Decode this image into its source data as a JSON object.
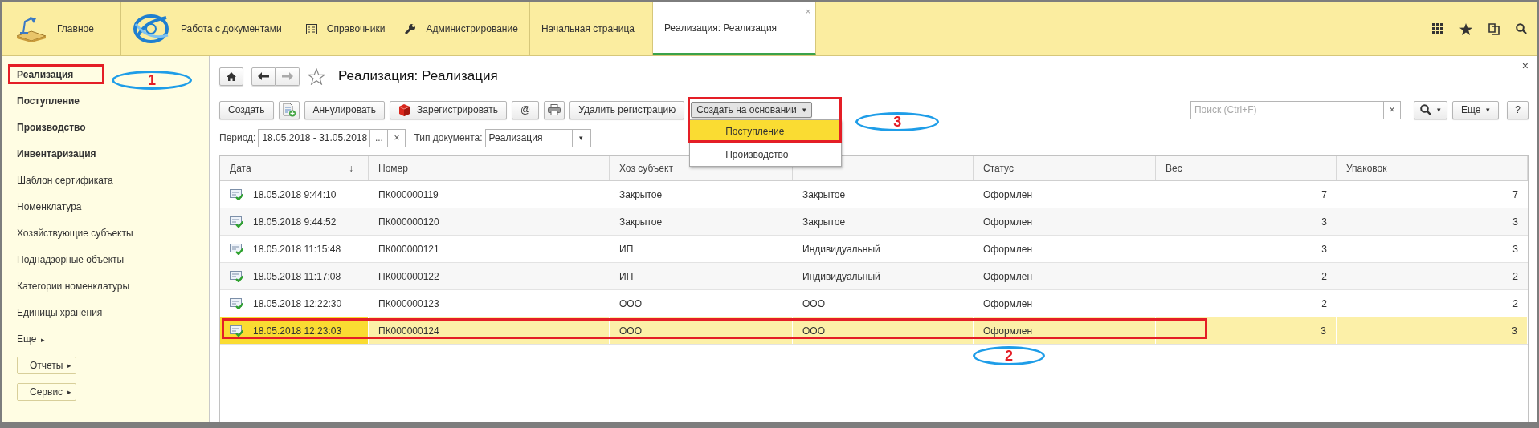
{
  "top_nav": {
    "sections": [
      {
        "label": "Главное"
      },
      {
        "label": "Работа с документами"
      },
      {
        "label": "Справочники"
      },
      {
        "label": "Администрирование"
      }
    ],
    "tabs": [
      {
        "label": "Начальная страница",
        "selected": false
      },
      {
        "label": "Реализация: Реализация",
        "selected": true,
        "close": "×"
      }
    ]
  },
  "sidebar": {
    "items": [
      {
        "label": "Реализация",
        "bold": true,
        "annotation": "1"
      },
      {
        "label": "Поступление",
        "bold": true
      },
      {
        "label": "Производство",
        "bold": true
      },
      {
        "label": "Инвентаризация",
        "bold": true
      },
      {
        "label": "Шаблон сертификата",
        "bold": false
      },
      {
        "label": "Номенклатура",
        "bold": false
      },
      {
        "label": "Хозяйствующие субъекты",
        "bold": false
      },
      {
        "label": "Поднадзорные объекты",
        "bold": false
      },
      {
        "label": "Категории номенклатуры",
        "bold": false
      },
      {
        "label": "Единицы хранения",
        "bold": false
      }
    ],
    "more": {
      "label": "Еще",
      "arrow": "▸"
    },
    "buttons": [
      {
        "label": "Отчеты",
        "arrow": "▸"
      },
      {
        "label": "Сервис",
        "arrow": "▸"
      }
    ]
  },
  "form": {
    "title": "Реализация: Реализация",
    "close": "×",
    "toolbar": [
      {
        "kind": "text",
        "label": "Создать"
      },
      {
        "kind": "add"
      },
      {
        "kind": "text",
        "label": "Аннулировать"
      },
      {
        "kind": "register",
        "label": "Зарегистрировать"
      },
      {
        "kind": "text",
        "label": "@"
      },
      {
        "kind": "print"
      },
      {
        "kind": "text",
        "label": "Удалить регистрацию"
      }
    ],
    "create_based_on": {
      "label": "Создать на основании",
      "caret": "▾",
      "expanded": true,
      "annotation": "3",
      "items": [
        {
          "label": "Поступление",
          "selected": true
        },
        {
          "label": "Производство",
          "selected": false
        }
      ]
    },
    "search": {
      "placeholder": "Поиск (Ctrl+F)",
      "clear": "×",
      "caret": "▾"
    },
    "more": {
      "label": "Еще",
      "caret": "▾"
    },
    "help": "?",
    "period": {
      "label": "Период:",
      "value": "18.05.2018 - 31.05.2018",
      "pick": "...",
      "clear": "×"
    },
    "doc_type": {
      "label": "Тип документа:",
      "value": "Реализация",
      "caret": "▾"
    }
  },
  "table": {
    "columns": [
      {
        "label": "Дата",
        "sort": "↓"
      },
      {
        "label": "Номер"
      },
      {
        "label": "Хоз субъект"
      },
      {},
      {
        "label": "Статус"
      },
      {
        "label": "Вес"
      },
      {
        "label": "Упаковок"
      }
    ],
    "rows": [
      {
        "selected": false,
        "cells": [
          "18.05.2018 9:44:10",
          "ПК000000119",
          "Закрытое",
          "Закрытое",
          "Оформлен",
          "7",
          "7"
        ]
      },
      {
        "selected": false,
        "cells": [
          "18.05.2018 9:44:52",
          "ПК000000120",
          "Закрытое",
          "Закрытое",
          "Оформлен",
          "3",
          "3"
        ]
      },
      {
        "selected": false,
        "cells": [
          "18.05.2018 11:15:48",
          "ПК000000121",
          "ИП",
          "Индивидуальный",
          "Оформлен",
          "3",
          "3"
        ]
      },
      {
        "selected": false,
        "cells": [
          "18.05.2018 11:17:08",
          "ПК000000122",
          "ИП",
          "Индивидуальный",
          "Оформлен",
          "2",
          "2"
        ]
      },
      {
        "selected": false,
        "cells": [
          "18.05.2018 12:22:30",
          "ПК000000123",
          "ООО",
          "ООО",
          "Оформлен",
          "2",
          "2"
        ]
      },
      {
        "selected": true,
        "annotation": "2",
        "cells": [
          "18.05.2018 12:23:03",
          "ПК000000124",
          "ООО",
          "ООО",
          "Оформлен",
          "3",
          "3"
        ]
      }
    ]
  }
}
